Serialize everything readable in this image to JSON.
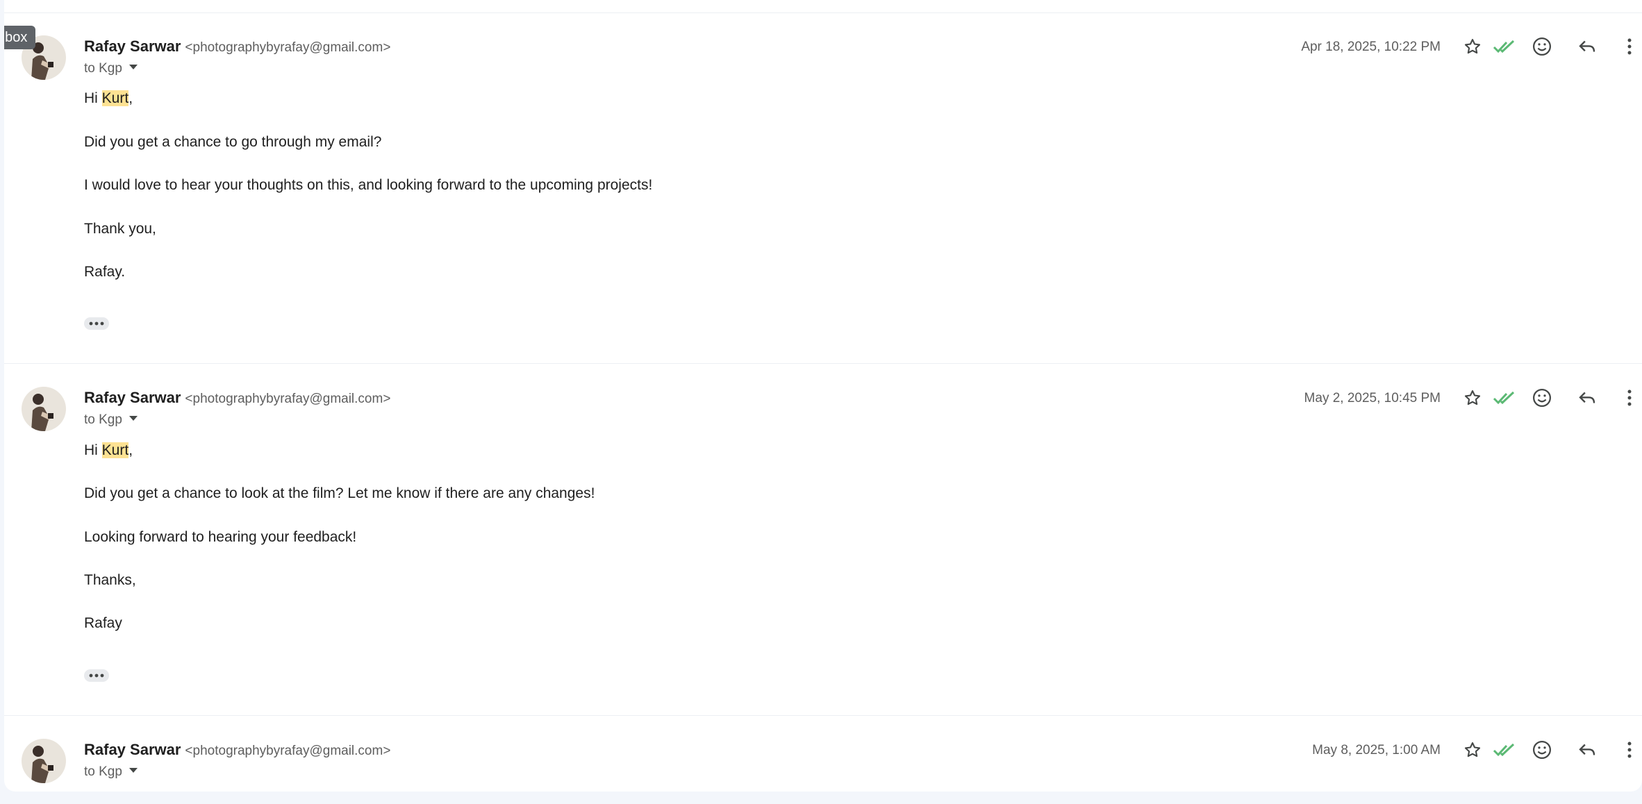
{
  "tooltip": {
    "label": "nbox"
  },
  "messages": [
    {
      "sender_name": "Rafay Sarwar",
      "sender_email": "<photographybyrafay@gmail.com>",
      "recipient": "to Kgp",
      "timestamp": "Apr 18, 2025, 10:22 PM",
      "greeting_prefix": "Hi ",
      "greeting_name": "Kurt",
      "greeting_suffix": ",",
      "lines": [
        "Did you get a chance to go through my email?",
        "I would love to hear your thoughts on this, and looking forward to the upcoming projects!",
        "Thank you,",
        "Rafay."
      ]
    },
    {
      "sender_name": "Rafay Sarwar",
      "sender_email": "<photographybyrafay@gmail.com>",
      "recipient": "to Kgp",
      "timestamp": "May 2, 2025, 10:45 PM",
      "greeting_prefix": "Hi ",
      "greeting_name": "Kurt",
      "greeting_suffix": ",",
      "lines": [
        "Did you get a chance to look at the film? Let me know if there are any changes!",
        "Looking forward to hearing your feedback!",
        "Thanks,",
        "Rafay"
      ]
    },
    {
      "sender_name": "Rafay Sarwar",
      "sender_email": "<photographybyrafay@gmail.com>",
      "recipient": "to Kgp",
      "timestamp": "May 8, 2025, 1:00 AM"
    }
  ],
  "icons": {
    "star": "star-icon",
    "read_receipt": "double-check-icon",
    "emoji": "emoji-icon",
    "reply": "reply-icon",
    "more": "more-vert-icon",
    "show_trimmed": "more-horiz-icon"
  },
  "colors": {
    "highlight": "#fde293",
    "check_green": "#5bb974",
    "tooltip_bg": "#5f6368"
  }
}
